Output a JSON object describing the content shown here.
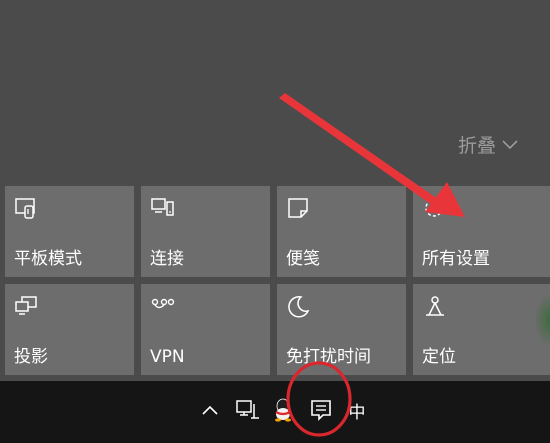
{
  "action_center": {
    "collapse_label": "折叠",
    "tiles": [
      {
        "label": "平板模式",
        "icon": "tablet-mode-icon"
      },
      {
        "label": "连接",
        "icon": "connect-icon"
      },
      {
        "label": "便笺",
        "icon": "note-icon"
      },
      {
        "label": "所有设置",
        "icon": "settings-gear-icon"
      },
      {
        "label": "投影",
        "icon": "project-icon"
      },
      {
        "label": "VPN",
        "icon": "vpn-icon"
      },
      {
        "label": "免打扰时间",
        "icon": "quiet-hours-moon-icon"
      },
      {
        "label": "定位",
        "icon": "location-icon"
      }
    ]
  },
  "taskbar": {
    "ime_label": "中",
    "icons": [
      "chevron-up-icon",
      "network-icon",
      "qq-icon",
      "action-center-icon"
    ]
  },
  "annotation": {
    "arrow_color": "#e8353a",
    "circle_color": "#d9272e"
  }
}
